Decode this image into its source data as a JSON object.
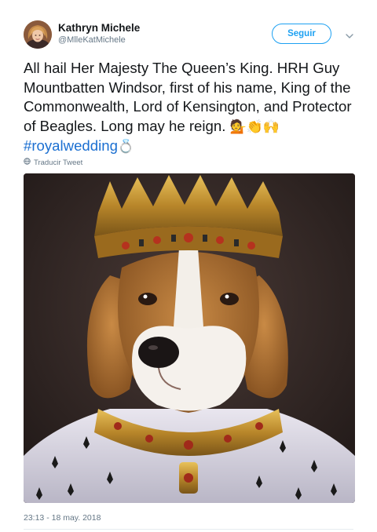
{
  "tweet": {
    "author_name": "Kathryn Michele",
    "author_handle": "@MlleKatMichele",
    "follow_label": "Seguir",
    "text_main": "All hail Her Majesty The Queen’s King. HRH Guy Mountbatten Windsor, first of his name, King of the Commonwealth, Lord of Kensington, and Protector of Beagles. Long may he reign. ",
    "emojis": "💁👏🙌",
    "hashtag": "#royalwedding",
    "hashtag_emoji": "💍",
    "translate_label": "Traducir Tweet",
    "timestamp": "23:13 - 18 may. 2018"
  },
  "colors": {
    "accent": "#1da1f2",
    "hashtag": "#1b6fd1",
    "secondary_text": "#657786"
  },
  "icons": [
    "avatar-photo",
    "chevron-down-icon",
    "globe-icon"
  ],
  "image": {
    "subject": "beagle wearing gold crown and ermine royal robe"
  }
}
